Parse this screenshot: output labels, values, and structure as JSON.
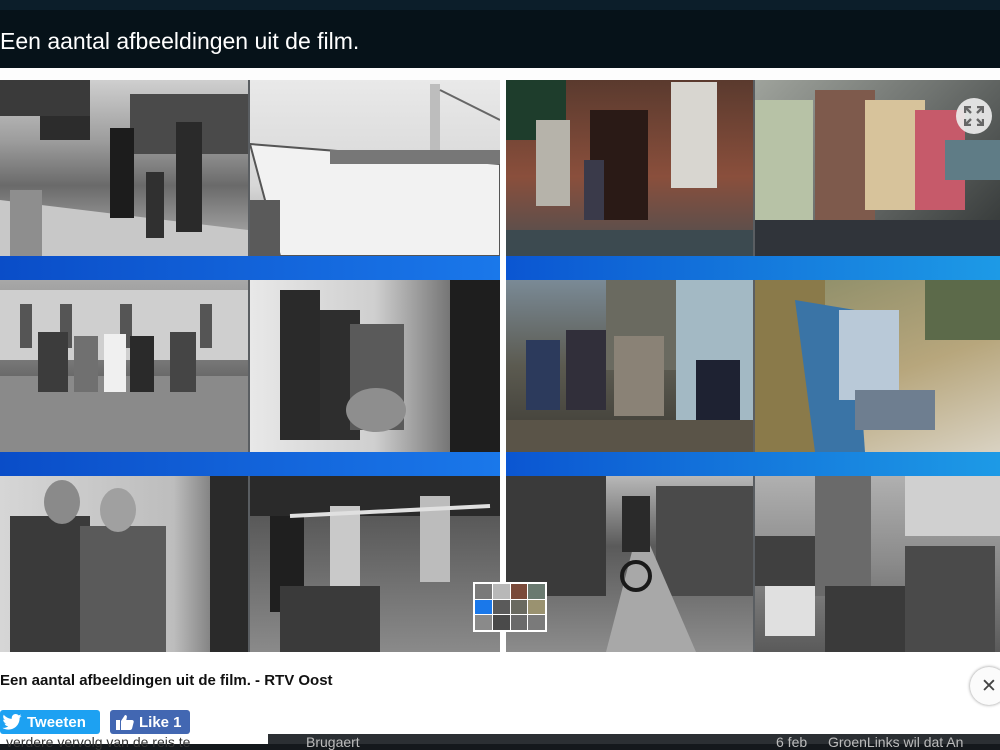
{
  "header": {
    "title": "Een aantal afbeeldingen uit de film."
  },
  "caption": {
    "text": "Een aantal afbeeldingen uit de film. - RTV Oost"
  },
  "share": {
    "tweet_label": "Tweeten",
    "like_label": "Like 1"
  },
  "colors": {
    "twitter": "#1da1f2",
    "facebook": "#4267b2",
    "band_blue": "#1a78ea"
  },
  "collage": {
    "photos": [
      {
        "name": "station-platform"
      },
      {
        "name": "ship-bow"
      },
      {
        "name": "building-doorway"
      },
      {
        "name": "children-on-bench"
      },
      {
        "name": "group-on-stairs"
      },
      {
        "name": "women-at-doorway"
      },
      {
        "name": "seated-group-outdoors"
      },
      {
        "name": "man-reading-deckchair"
      },
      {
        "name": "two-women-portrait"
      },
      {
        "name": "children-dancing"
      },
      {
        "name": "child-on-bicycle"
      },
      {
        "name": "schoolchildren-class"
      }
    ]
  },
  "icons": {
    "expand": "expand-icon",
    "close": "close-icon",
    "twitter": "twitter-bird-icon",
    "facebook": "thumbs-up-icon"
  },
  "background_text": {
    "left": "verdere vervolg van de reis te",
    "mid": "Brugaert",
    "right_date": "6 feb",
    "right_headline": "GroenLinks wil dat An"
  }
}
